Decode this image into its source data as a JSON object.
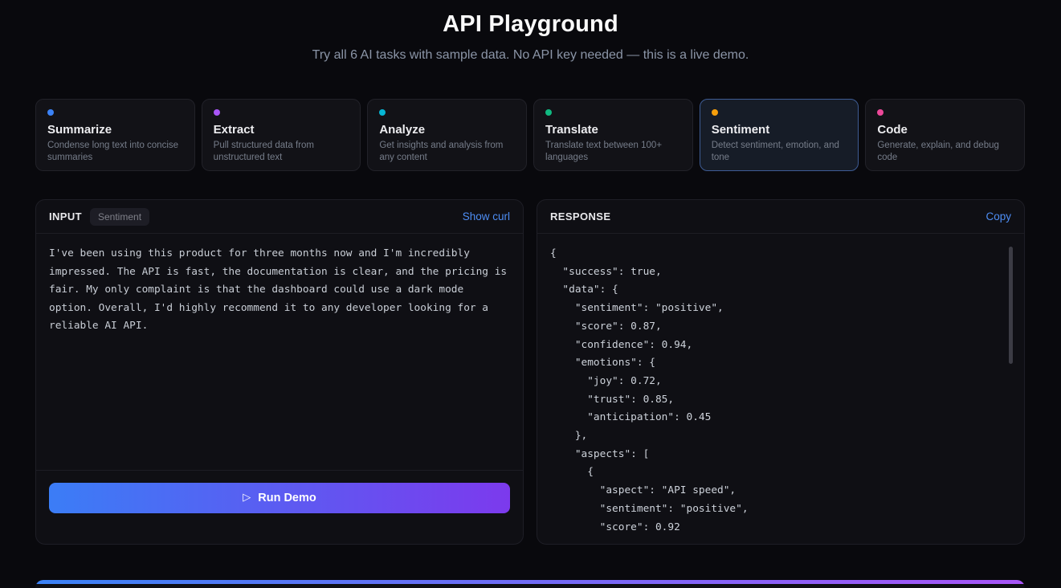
{
  "page": {
    "title": "API Playground",
    "subtitle": "Try all 6 AI tasks with sample data. No API key needed — this is a live demo."
  },
  "tasks": [
    {
      "label": "Summarize",
      "description": "Condense long text into concise summaries",
      "dot_color": "#3b82f6",
      "selected": false
    },
    {
      "label": "Extract",
      "description": "Pull structured data from unstructured text",
      "dot_color": "#a855f7",
      "selected": false
    },
    {
      "label": "Analyze",
      "description": "Get insights and analysis from any content",
      "dot_color": "#06b6d4",
      "selected": false
    },
    {
      "label": "Translate",
      "description": "Translate text between 100+ languages",
      "dot_color": "#10b981",
      "selected": false
    },
    {
      "label": "Sentiment",
      "description": "Detect sentiment, emotion, and tone",
      "dot_color": "#f59e0b",
      "selected": true
    },
    {
      "label": "Code",
      "description": "Generate, explain, and debug code",
      "dot_color": "#ec4899",
      "selected": false
    }
  ],
  "input_panel": {
    "label": "INPUT",
    "badge": "Sentiment",
    "show_curl_label": "Show curl",
    "textarea_value": "I've been using this product for three months now and I'm incredibly impressed. The API is fast, the documentation is clear, and the pricing is fair. My only complaint is that the dashboard could use a dark mode option. Overall, I'd highly recommend it to any developer looking for a reliable AI API.",
    "run_button_icon": "▷",
    "run_button_label": "Run Demo"
  },
  "response_panel": {
    "label": "RESPONSE",
    "copy_label": "Copy",
    "json_text": "{\n  \"success\": true,\n  \"data\": {\n    \"sentiment\": \"positive\",\n    \"score\": 0.87,\n    \"confidence\": 0.94,\n    \"emotions\": {\n      \"joy\": 0.72,\n      \"trust\": 0.85,\n      \"anticipation\": 0.45\n    },\n    \"aspects\": [\n      {\n        \"aspect\": \"API speed\",\n        \"sentiment\": \"positive\",\n        \"score\": 0.92"
  },
  "colors": {
    "background": "#09090d",
    "panel_background": "#0f0f14",
    "card_background": "#121217",
    "selected_border": "#3e5c94",
    "link_blue": "#4e8ef5",
    "button_gradient_start": "#3b7df6",
    "button_gradient_end": "#7c3aed",
    "bottom_bar_gradient_start": "#3b82f6",
    "bottom_bar_gradient_end": "#a855f7"
  }
}
